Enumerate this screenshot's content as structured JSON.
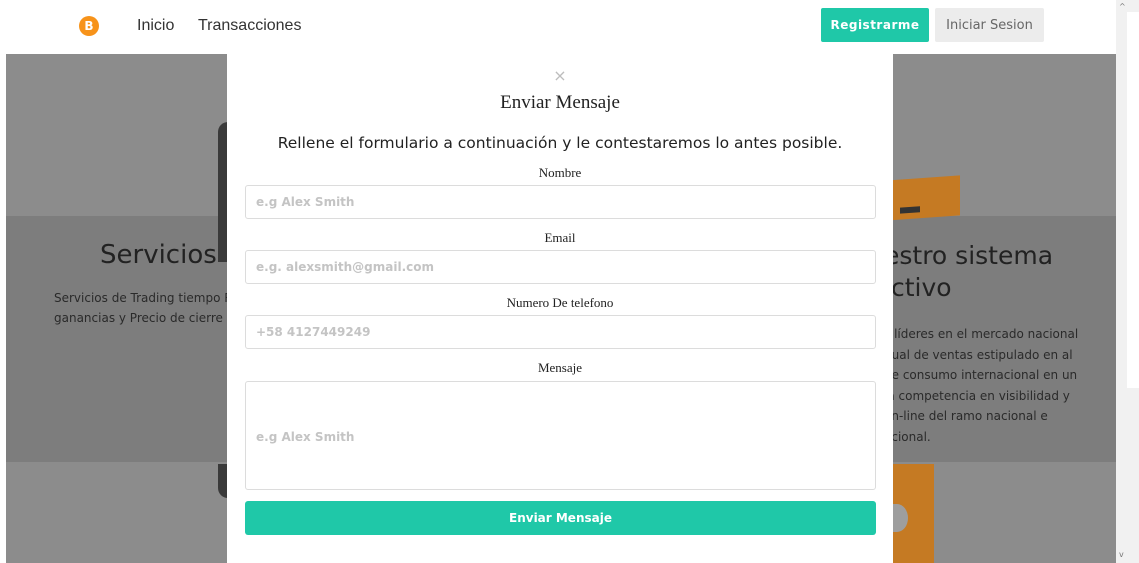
{
  "navbar": {
    "logo_symbol": "B",
    "links": [
      "Inicio",
      "Transacciones"
    ],
    "register_label": "Registrarme",
    "login_label": "Iniciar Sesion",
    "accent_color": "#1fc8a8",
    "logo_color": "#f7931a"
  },
  "background": {
    "left_title": "Servicios",
    "left_text": [
      "Servicios de Trading tiempo R",
      "ganancias y Precio de cierre d"
    ],
    "right_title": [
      "estro sistema",
      "ictivo"
    ],
    "right_text": [
      "s líderes en el mercado nacional",
      "nual de ventas estipulado en al",
      "de consumo internacional en un",
      "la competencia en visibilidad y",
      "on-line del ramo nacional e",
      "acional."
    ]
  },
  "modal": {
    "close_symbol": "×",
    "title": "Enviar Mensaje",
    "subtitle": "Rellene el formulario a continuación y le contestaremos lo antes posible.",
    "fields": {
      "name": {
        "label": "Nombre",
        "placeholder": "e.g Alex Smith"
      },
      "email": {
        "label": "Email",
        "placeholder": "e.g. alexsmith@gmail.com"
      },
      "phone": {
        "label": "Numero De telefono",
        "placeholder": "+58 4127449249"
      },
      "message": {
        "label": "Mensaje",
        "placeholder": "e.g Alex Smith"
      }
    },
    "submit_label": "Enviar Mensaje"
  },
  "scrollbar": {
    "up_arrow": "^",
    "down_arrow": "v"
  }
}
